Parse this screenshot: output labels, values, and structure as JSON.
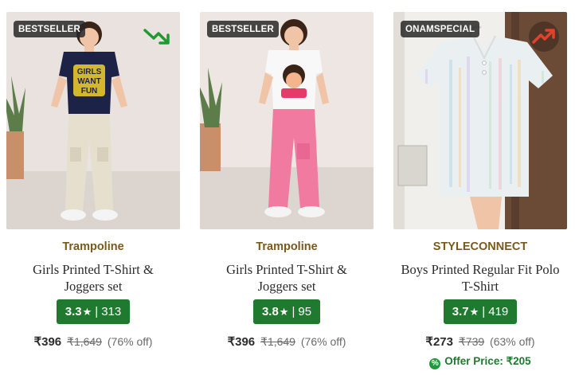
{
  "products": [
    {
      "badge": "BESTSELLER",
      "trend_icon": "trending-down-icon",
      "trend_color": "#1e9a2e",
      "brand": "Trampoline",
      "title": "Girls Printed T-Shirt & Joggers set",
      "rating": "3.3",
      "rating_count": "313",
      "price": "₹396",
      "mrp": "₹1,649",
      "discount": "(76% off)",
      "shirt_print": [
        "GIRLS",
        "WANT",
        "FUN"
      ]
    },
    {
      "badge": "BESTSELLER",
      "brand": "Trampoline",
      "title": "Girls Printed T-Shirt & Joggers set",
      "rating": "3.8",
      "rating_count": "95",
      "price": "₹396",
      "mrp": "₹1,649",
      "discount": "(76% off)"
    },
    {
      "badge": "ONAMSPECIAL",
      "trend_icon": "trending-up-icon",
      "trend_color": "#d9452a",
      "brand": "STYLECONNECT",
      "title": "Boys Printed Regular Fit Polo T-Shirt",
      "rating": "3.7",
      "rating_count": "419",
      "price": "₹273",
      "mrp": "₹739",
      "discount": "(63% off)",
      "offer_price": "Offer Price: ₹205"
    }
  ],
  "colors": {
    "brand_text": "#7a5a1c",
    "rating_bg": "#1f7a2f",
    "offer_text": "#1f7a2f"
  },
  "rating_star": "★",
  "rating_separator": "|",
  "offer_icon": "%"
}
